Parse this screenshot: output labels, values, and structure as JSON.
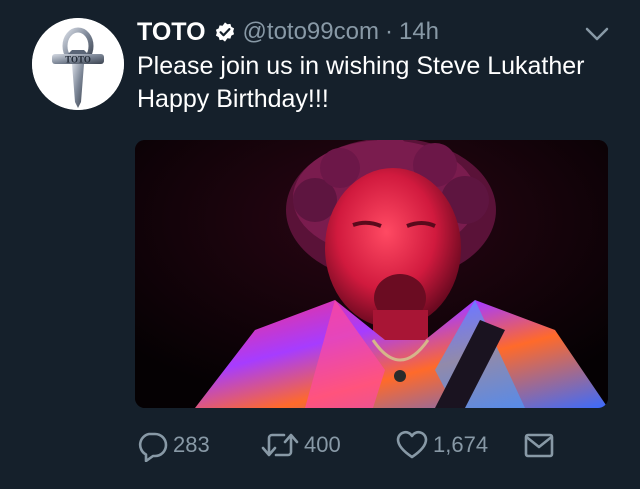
{
  "tweet": {
    "author_name": "TOTO",
    "verified": true,
    "handle": "@toto99com",
    "separator": "·",
    "time": "14h",
    "text": "Please join us in wishing Steve Lukather Happy Birthday!!!",
    "avatar_text": "TOTO",
    "media_description_icon": "photo-of-guitarist-icon"
  },
  "actions": {
    "reply_count": "283",
    "retweet_count": "400",
    "like_count": "1,674"
  },
  "icons": {
    "reply": "reply-icon",
    "retweet": "retweet-icon",
    "like": "heart-icon",
    "dm": "envelope-icon",
    "more": "chevron-down-icon",
    "verified": "verified-badge-icon"
  },
  "colors": {
    "background": "#15202b",
    "text": "#ffffff",
    "muted": "#8899a6",
    "verified": "#ffffff"
  }
}
